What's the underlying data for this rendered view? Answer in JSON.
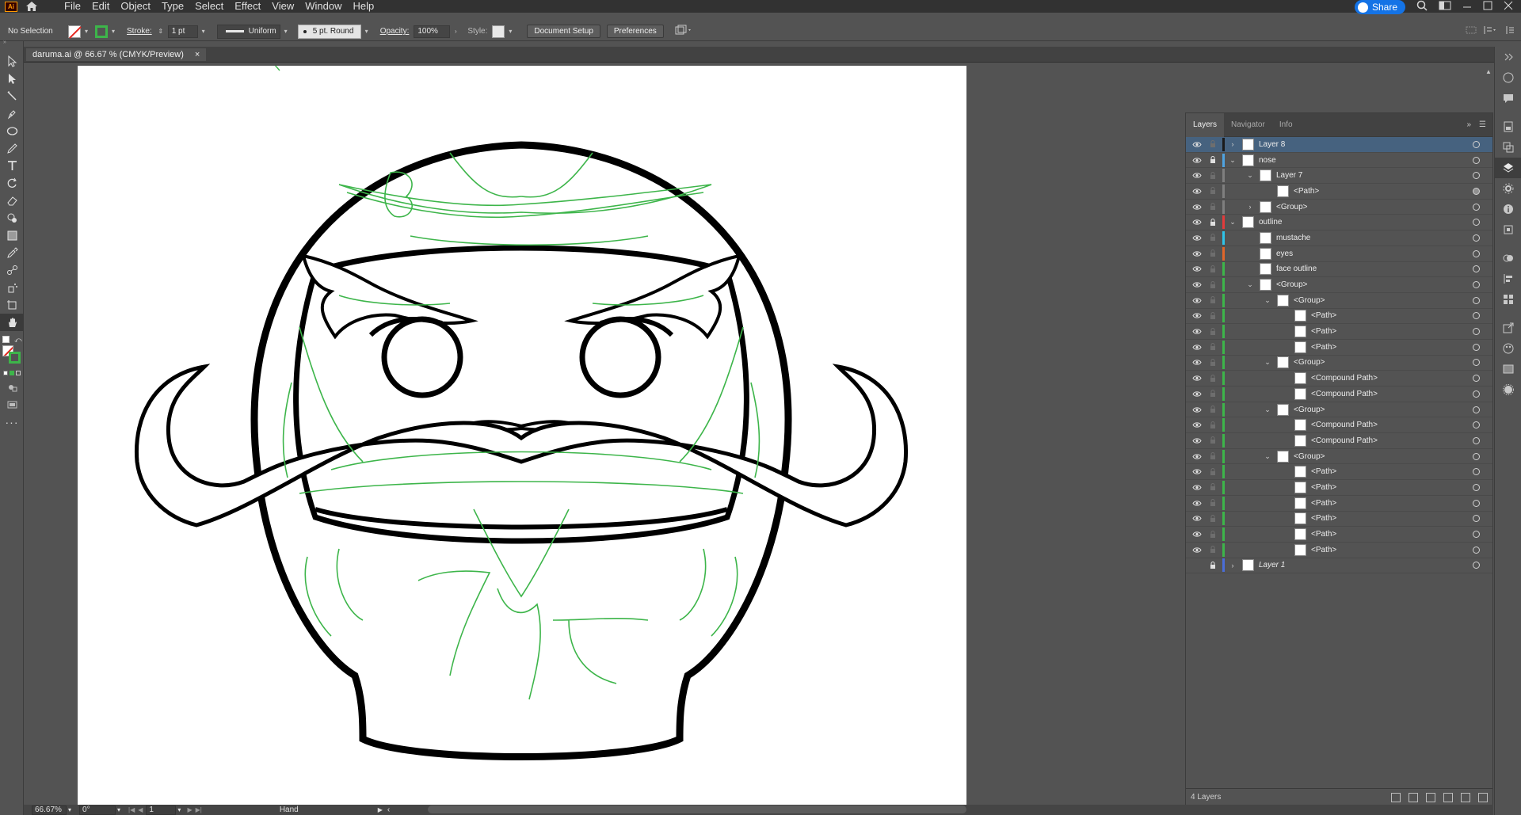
{
  "app": {
    "logo": "Ai",
    "menu": [
      "File",
      "Edit",
      "Object",
      "Type",
      "Select",
      "Effect",
      "View",
      "Window",
      "Help"
    ],
    "share_label": "Share"
  },
  "control_bar": {
    "selection_status": "No Selection",
    "stroke_label": "Stroke:",
    "stroke_weight": "1 pt",
    "stroke_profile": "Uniform",
    "brush": "5 pt. Round",
    "opacity_label": "Opacity:",
    "opacity_value": "100%",
    "style_label": "Style:",
    "document_setup": "Document Setup",
    "preferences": "Preferences"
  },
  "document_tab": {
    "title": "daruma.ai @ 66.67 % (CMYK/Preview)",
    "close": "×"
  },
  "layers_panel": {
    "tabs": [
      "Layers",
      "Navigator",
      "Info"
    ],
    "active_tab": "Layers",
    "footer_count": "4 Layers",
    "rows": [
      {
        "name": "Layer 8",
        "depth": 0,
        "expanded": false,
        "color": "#1a1a1a",
        "selected": true,
        "locked": false
      },
      {
        "name": "nose",
        "depth": 0,
        "expanded": true,
        "color": "#4fa3e0",
        "selected": false,
        "locked": true
      },
      {
        "name": "Layer 7",
        "depth": 1,
        "expanded": true,
        "color": "#7f7f7f",
        "selected": false,
        "locked": false
      },
      {
        "name": "<Path>",
        "depth": 2,
        "expanded": null,
        "color": "#7f7f7f",
        "selected": false,
        "locked": false
      },
      {
        "name": "<Group>",
        "depth": 1,
        "expanded": false,
        "color": "#7f7f7f",
        "selected": false,
        "locked": false
      },
      {
        "name": "outline",
        "depth": 0,
        "expanded": true,
        "color": "#e33b3b",
        "selected": false,
        "locked": true
      },
      {
        "name": "mustache",
        "depth": 1,
        "expanded": null,
        "color": "#2ec4ea",
        "selected": false,
        "locked": false
      },
      {
        "name": "eyes",
        "depth": 1,
        "expanded": null,
        "color": "#e0662a",
        "selected": false,
        "locked": false
      },
      {
        "name": "face outline",
        "depth": 1,
        "expanded": null,
        "color": "#3db54a",
        "selected": false,
        "locked": false
      },
      {
        "name": "<Group>",
        "depth": 1,
        "expanded": true,
        "color": "#3db54a",
        "selected": false,
        "locked": false
      },
      {
        "name": "<Group>",
        "depth": 2,
        "expanded": true,
        "color": "#3db54a",
        "selected": false,
        "locked": false
      },
      {
        "name": "<Path>",
        "depth": 3,
        "expanded": null,
        "color": "#3db54a",
        "selected": false,
        "locked": false
      },
      {
        "name": "<Path>",
        "depth": 3,
        "expanded": null,
        "color": "#3db54a",
        "selected": false,
        "locked": false
      },
      {
        "name": "<Path>",
        "depth": 3,
        "expanded": null,
        "color": "#3db54a",
        "selected": false,
        "locked": false
      },
      {
        "name": "<Group>",
        "depth": 2,
        "expanded": true,
        "color": "#3db54a",
        "selected": false,
        "locked": false
      },
      {
        "name": "<Compound Path>",
        "depth": 3,
        "expanded": null,
        "color": "#3db54a",
        "selected": false,
        "locked": false
      },
      {
        "name": "<Compound Path>",
        "depth": 3,
        "expanded": null,
        "color": "#3db54a",
        "selected": false,
        "locked": false
      },
      {
        "name": "<Group>",
        "depth": 2,
        "expanded": true,
        "color": "#3db54a",
        "selected": false,
        "locked": false
      },
      {
        "name": "<Compound Path>",
        "depth": 3,
        "expanded": null,
        "color": "#3db54a",
        "selected": false,
        "locked": false
      },
      {
        "name": "<Compound Path>",
        "depth": 3,
        "expanded": null,
        "color": "#3db54a",
        "selected": false,
        "locked": false
      },
      {
        "name": "<Group>",
        "depth": 2,
        "expanded": true,
        "color": "#3db54a",
        "selected": false,
        "locked": false
      },
      {
        "name": "<Path>",
        "depth": 3,
        "expanded": null,
        "color": "#3db54a",
        "selected": false,
        "locked": false
      },
      {
        "name": "<Path>",
        "depth": 3,
        "expanded": null,
        "color": "#3db54a",
        "selected": false,
        "locked": false
      },
      {
        "name": "<Path>",
        "depth": 3,
        "expanded": null,
        "color": "#3db54a",
        "selected": false,
        "locked": false
      },
      {
        "name": "<Path>",
        "depth": 3,
        "expanded": null,
        "color": "#3db54a",
        "selected": false,
        "locked": false
      },
      {
        "name": "<Path>",
        "depth": 3,
        "expanded": null,
        "color": "#3db54a",
        "selected": false,
        "locked": false
      },
      {
        "name": "<Path>",
        "depth": 3,
        "expanded": null,
        "color": "#3db54a",
        "selected": false,
        "locked": false
      },
      {
        "name": "Layer 1",
        "depth": 0,
        "expanded": false,
        "color": "#4a6dd8",
        "selected": false,
        "locked": true,
        "hidden": true,
        "italic": true
      }
    ]
  },
  "status_bar": {
    "zoom": "66.67%",
    "rotation": "0°",
    "artboard_number": "1",
    "tool": "Hand"
  },
  "colors": {
    "accent": "#1473e6",
    "sketch_green": "#3db54a",
    "selection": "#46627f"
  }
}
